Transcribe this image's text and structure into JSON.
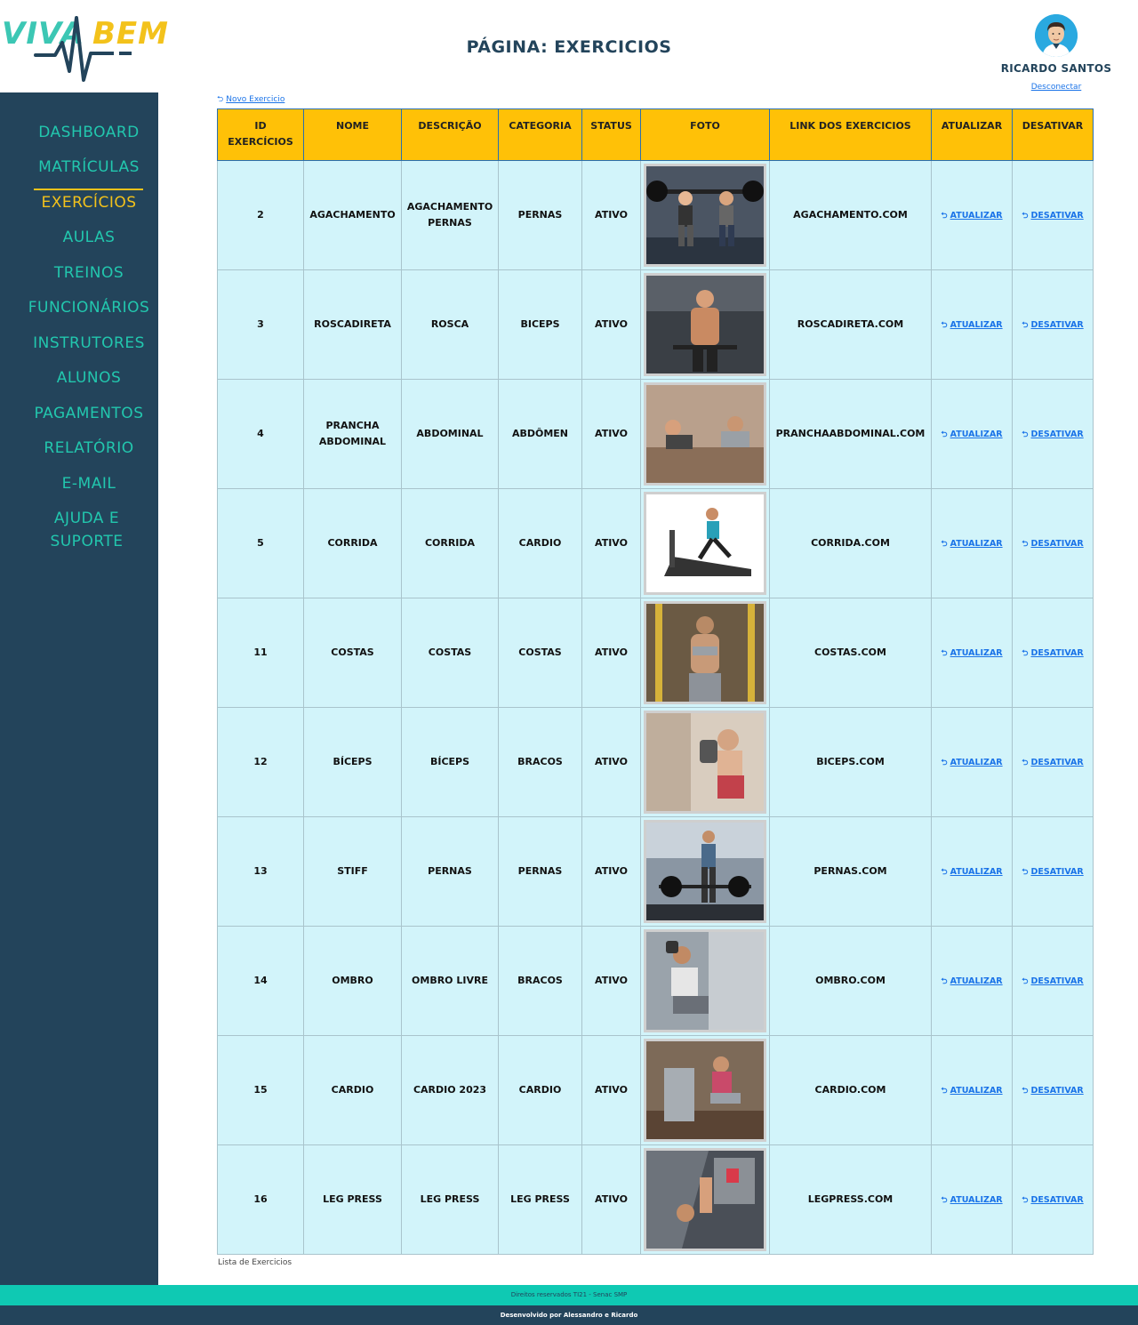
{
  "logo": {
    "part1": "VIVA",
    "part2": "BEM"
  },
  "header": {
    "title": "PÁGINA: EXERCICIOS"
  },
  "user": {
    "name": "RICARDO SANTOS",
    "logout": "Desconectar"
  },
  "sidebar": {
    "items": [
      {
        "label": "DASHBOARD"
      },
      {
        "label": "MATRÍCULAS"
      },
      {
        "label": "EXERCÍCIOS",
        "active": true
      },
      {
        "label": "AULAS"
      },
      {
        "label": "TREINOS"
      },
      {
        "label": "FUNCIONÁRIOS"
      },
      {
        "label": "INSTRUTORES"
      },
      {
        "label": "ALUNOS"
      },
      {
        "label": "PAGAMENTOS"
      },
      {
        "label": "RELATÓRIO"
      },
      {
        "label": "E-MAIL"
      },
      {
        "label": "AJUDA E SUPORTE"
      }
    ]
  },
  "toolbar": {
    "new_label": "Novo Exercicio"
  },
  "table": {
    "headers": [
      "ID EXERCÍCIOS",
      "NOME",
      "DESCRIÇÃO",
      "CATEGORIA",
      "STATUS",
      "FOTO",
      "LINK DOS EXERCICIOS",
      "ATUALIZAR",
      "DESATIVAR"
    ],
    "update_label": "ATUALIZAR",
    "deactivate_label": "DESATIVAR",
    "rows": [
      {
        "id": "2",
        "name": "AGACHAMENTO",
        "description": "AGACHAMENTO PERNAS",
        "category": "PERNAS",
        "status": "ATIVO",
        "link": "AGACHAMENTO.COM"
      },
      {
        "id": "3",
        "name": "ROSCADIRETA",
        "description": "ROSCA",
        "category": "BICEPS",
        "status": "ATIVO",
        "link": "ROSCADIRETA.COM"
      },
      {
        "id": "4",
        "name": "PRANCHA ABDOMINAL",
        "description": "ABDOMINAL",
        "category": "ABDÔMEN",
        "status": "ATIVO",
        "link": "PRANCHAABDOMINAL.COM"
      },
      {
        "id": "5",
        "name": "CORRIDA",
        "description": "CORRIDA",
        "category": "CARDIO",
        "status": "ATIVO",
        "link": "CORRIDA.COM"
      },
      {
        "id": "11",
        "name": "COSTAS",
        "description": "COSTAS",
        "category": "COSTAS",
        "status": "ATIVO",
        "link": "COSTAS.COM"
      },
      {
        "id": "12",
        "name": "BÍCEPS",
        "description": "BÍCEPS",
        "category": "BRACOS",
        "status": "ATIVO",
        "link": "BICEPS.COM"
      },
      {
        "id": "13",
        "name": "STIFF",
        "description": "PERNAS",
        "category": "PERNAS",
        "status": "ATIVO",
        "link": "PERNAS.COM"
      },
      {
        "id": "14",
        "name": "OMBRO",
        "description": "OMBRO LIVRE",
        "category": "BRACOS",
        "status": "ATIVO",
        "link": "OMBRO.COM"
      },
      {
        "id": "15",
        "name": "CARDIO",
        "description": "CARDIO 2023",
        "category": "CARDIO",
        "status": "ATIVO",
        "link": "CARDIO.COM"
      },
      {
        "id": "16",
        "name": "LEG PRESS",
        "description": "LEG PRESS",
        "category": "LEG PRESS",
        "status": "ATIVO",
        "link": "LEGPRESS.COM"
      }
    ]
  },
  "caption": "Lista de Exercicios",
  "footer": {
    "rights": "Direitos reservados TI21 - Senac SMP",
    "credits": "Desenvolvido por Alessandro e Ricardo"
  },
  "colors": {
    "sidebar_bg": "#23445b",
    "nav_text": "#22c7ae",
    "nav_active": "#f3c21b",
    "table_header": "#ffc107",
    "row_bg": "#d2f4fa",
    "footer_top": "#0fc9b3",
    "link": "#1a73e8"
  },
  "icons": {
    "avatar": "user-avatar-icon",
    "action": "return-arrow-icon"
  }
}
